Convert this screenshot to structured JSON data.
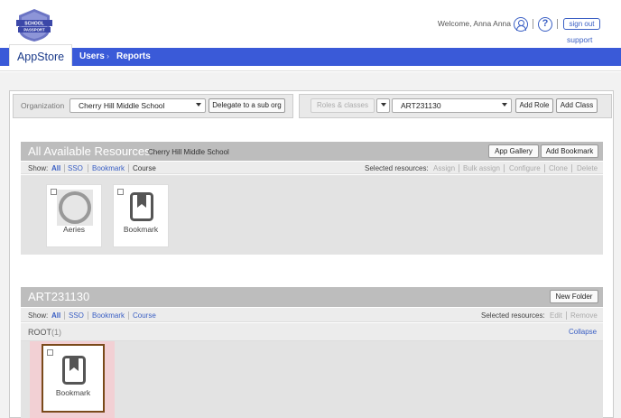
{
  "header": {
    "logo_text_top": "SCHOOL",
    "logo_text_bottom": "PASSPORT",
    "welcome": "Welcome, Anna Anna",
    "signout_label": "sign out",
    "support_label": "support",
    "accent_color": "#3a5ad8"
  },
  "nav": {
    "app_tab": "AppStore",
    "users": "Users",
    "chevron": "›",
    "reports": "Reports"
  },
  "org": {
    "label": "Organization",
    "selected": "Cherry Hill Middle School",
    "delegate_label": "Delegate to a sub org"
  },
  "roles": {
    "roles_classes_label": "Roles & classes",
    "selected_class": "ART231130",
    "add_role_label": "Add Role",
    "add_class_label": "Add Class"
  },
  "available": {
    "title": "All Available Resources",
    "subtitle": "Cherry Hill Middle School",
    "app_gallery_label": "App Gallery",
    "add_bookmark_label": "Add Bookmark",
    "show_label": "Show:",
    "filters": [
      "All",
      "SSO",
      "Bookmark",
      "Course"
    ],
    "selected_resources_label": "Selected resources:",
    "actions": [
      "Assign",
      "Bulk assign",
      "Configure",
      "Clone",
      "Delete"
    ],
    "tiles": [
      {
        "label": "Aeries",
        "icon": "ring-icon"
      },
      {
        "label": "Bookmark",
        "icon": "bookmark-icon"
      }
    ]
  },
  "class_section": {
    "title": "ART231130",
    "new_folder_label": "New Folder",
    "show_label": "Show:",
    "filters": [
      "All",
      "SSO",
      "Bookmark",
      "Course"
    ],
    "selected_resources_label": "Selected resources:",
    "actions": [
      "Edit",
      "Remove"
    ],
    "root_label": "ROOT",
    "root_count": "(1)",
    "collapse_label": "Collapse",
    "tiles": [
      {
        "label": "Bookmark",
        "icon": "bookmark-icon"
      }
    ]
  }
}
